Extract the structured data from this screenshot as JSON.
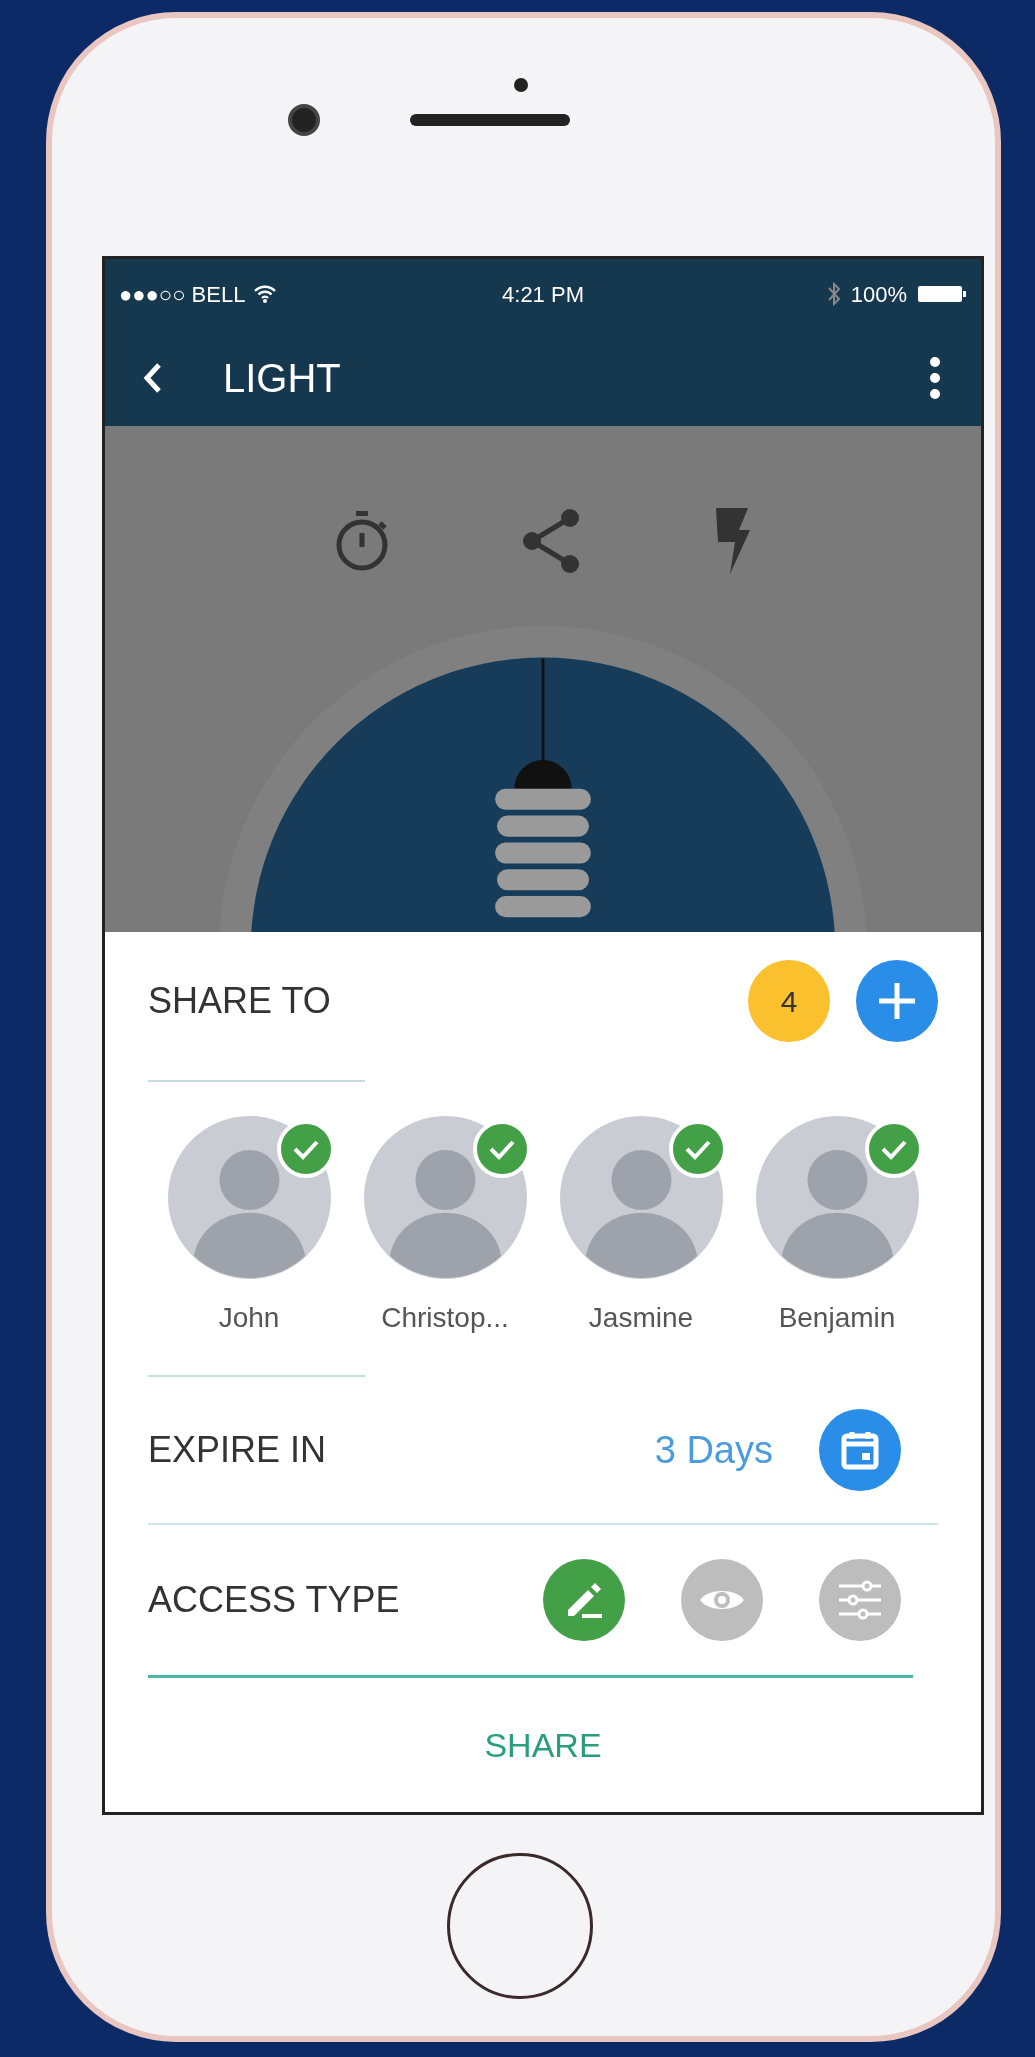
{
  "status_bar": {
    "carrier": "●●●○○ BELL",
    "time": "4:21 PM",
    "battery": "100%"
  },
  "header": {
    "title": "LIGHT"
  },
  "share_to": {
    "label": "SHARE TO",
    "count": "4",
    "people": [
      {
        "name": "John",
        "selected": true
      },
      {
        "name": "Christop...",
        "selected": true
      },
      {
        "name": "Jasmine",
        "selected": true
      },
      {
        "name": "Benjamin",
        "selected": true
      }
    ]
  },
  "expire_in": {
    "label": "EXPIRE IN",
    "value": "3 Days"
  },
  "access_type": {
    "label": "ACCESS TYPE",
    "options": [
      {
        "kind": "edit",
        "selected": true
      },
      {
        "kind": "view",
        "selected": false
      },
      {
        "kind": "settings",
        "selected": false
      }
    ]
  },
  "share_button": "SHARE"
}
